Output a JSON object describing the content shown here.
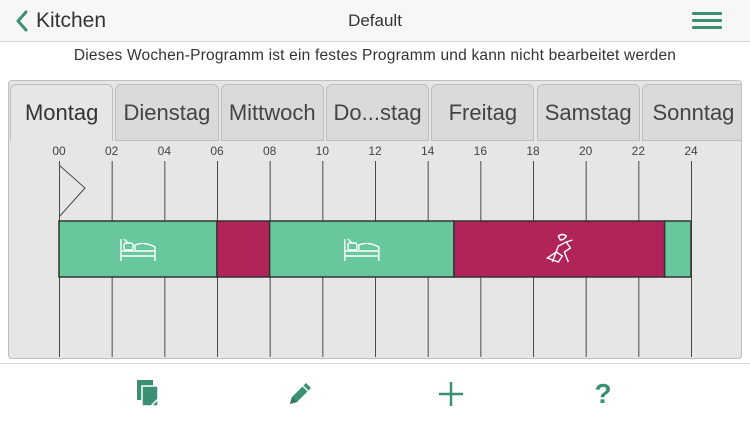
{
  "header": {
    "back_label": "Kitchen",
    "title": "Default",
    "menu_icon": "hamburger-menu-icon"
  },
  "notice": "Dieses Wochen-Programm ist ein festes Programm und kann nicht bearbeitet werden",
  "days": [
    "Montag",
    "Dienstag",
    "Mittwoch",
    "Do...stag",
    "Freitag",
    "Samstag",
    "Sonntag"
  ],
  "active_day": "Montag",
  "hour_labels": [
    "00",
    "02",
    "04",
    "06",
    "08",
    "10",
    "12",
    "14",
    "16",
    "18",
    "20",
    "22",
    "24"
  ],
  "schedule": [
    {
      "start": 0,
      "end": 6,
      "mode": "sleep",
      "icon": "bed-icon"
    },
    {
      "start": 6,
      "end": 8,
      "mode": "comfort",
      "icon": ""
    },
    {
      "start": 8,
      "end": 15,
      "mode": "sleep",
      "icon": "bed-icon"
    },
    {
      "start": 15,
      "end": 23,
      "mode": "comfort",
      "icon": "lounge-chair-icon"
    },
    {
      "start": 23,
      "end": 24,
      "mode": "sleep",
      "icon": ""
    }
  ],
  "colors": {
    "sleep": "#69c89b",
    "comfort": "#b12459",
    "accent": "#3b8f74"
  },
  "current_time_hour": 0.5,
  "toolbar": [
    "copy-icon",
    "edit-pencil-icon",
    "add-plus-icon",
    "help-question-icon"
  ],
  "toolbar_help_text": "?"
}
